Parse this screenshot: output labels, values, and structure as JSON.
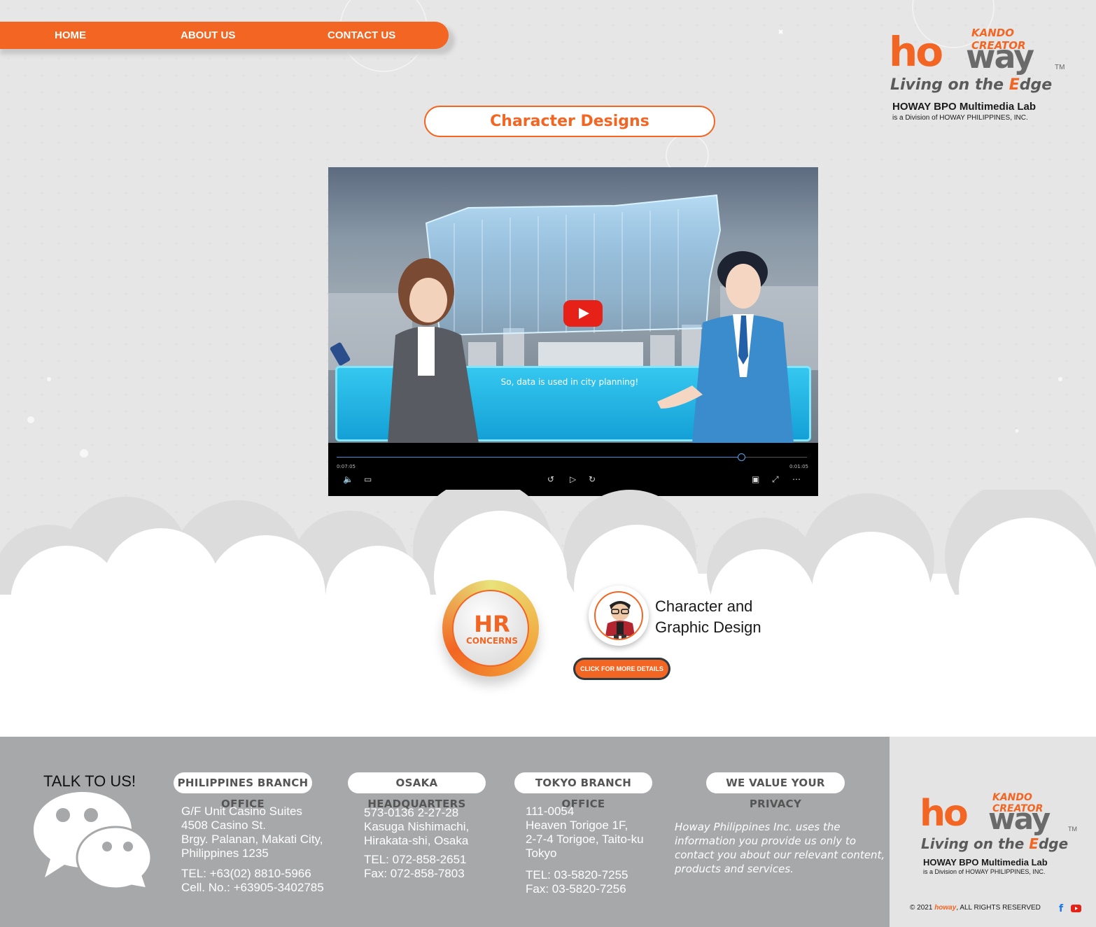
{
  "nav": {
    "items": [
      "HOME",
      "ABOUT US",
      "CONTACT US"
    ]
  },
  "logo": {
    "kando": "KANDO CREATOR",
    "word_ho": "ho",
    "word_way": "way",
    "tm": "TM",
    "tagline_pre": "Living on the ",
    "tagline_e": "E",
    "tagline_post": "dge",
    "lab": "HOWAY BPO Multimedia Lab",
    "division": "is a Division of HOWAY PHILIPPINES, INC."
  },
  "page_title": "Character Designs",
  "video": {
    "subtitle": "So, data is used in city planning!",
    "elapsed": "0:07:05",
    "remaining": "0:01:05",
    "progress": 0.86
  },
  "services": {
    "hr_top": "HR",
    "hr_bottom": "CONCERNS",
    "title_line1": "Character and",
    "title_line2": "Graphic Design",
    "more_button": "CLICK FOR MORE DETAILS"
  },
  "footer": {
    "talk": "TALK TO US!",
    "offices": [
      {
        "heading": "PHILIPPINES BRANCH OFFICE",
        "address": [
          "G/F Unit Casino Suites",
          "4508 Casino St.",
          "Brgy. Palanan, Makati City,",
          "Philippines 1235"
        ],
        "contacts": [
          "TEL: +63(02) 8810-5966",
          "Cell. No.: +63905-3402785"
        ]
      },
      {
        "heading": "OSAKA HEADQUARTERS",
        "address": [
          "573-0136 2-27-28",
          "Kasuga Nishimachi,",
          "Hirakata-shi, Osaka"
        ],
        "contacts": [
          "TEL: 072-858-2651",
          "Fax: 072-858-7803"
        ]
      },
      {
        "heading": "TOKYO BRANCH OFFICE",
        "address": [
          "111-0054",
          "Heaven Torigoe 1F,",
          "2-7-4 Torigoe, Taito-ku",
          "Tokyo"
        ],
        "contacts": [
          "TEL: 03-5820-7255",
          "Fax: 03-5820-7256"
        ]
      }
    ],
    "privacy_heading": "WE VALUE YOUR PRIVACY",
    "privacy_text": "Howay Philippines Inc. uses the information you provide  us only to contact you about our relevant content, products and services.",
    "copyright_pre": "© 2021",
    "copyright_brand": "howay",
    "copyright_post": ", ALL RIGHTS RESERVED"
  },
  "colors": {
    "accent": "#f26522",
    "footer_bg": "#a7a8aa",
    "page_bg": "#e6e6e6"
  },
  "icons": {
    "social": [
      "facebook-icon",
      "youtube-icon"
    ],
    "chat": "chat-bubbles-icon"
  }
}
